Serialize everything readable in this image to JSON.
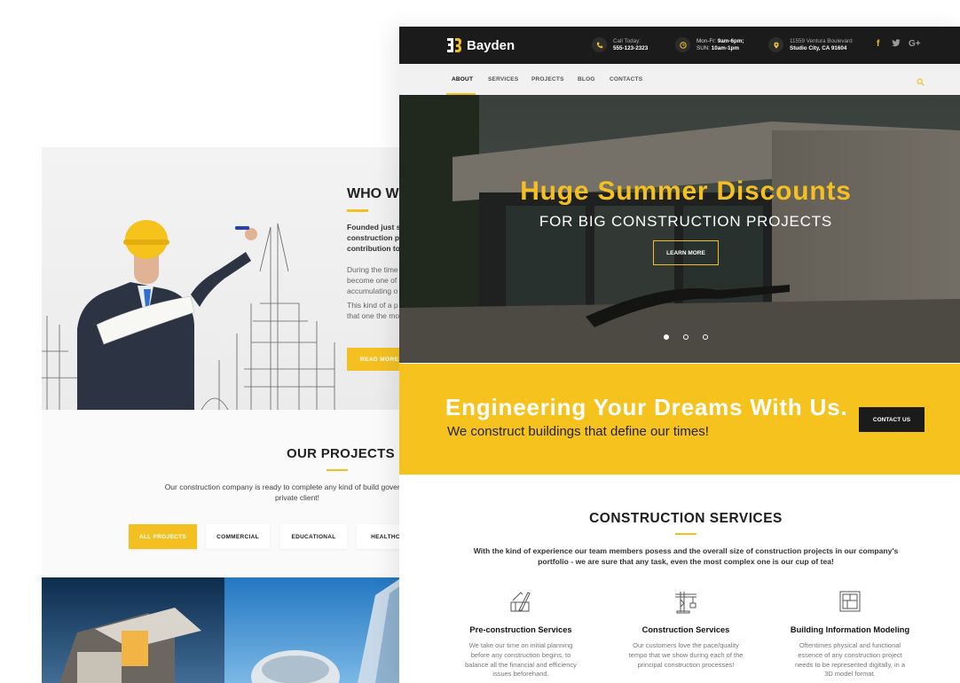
{
  "colors": {
    "accent": "#f4c021",
    "dark": "#1b1b1b",
    "band": "#f6c31e"
  },
  "back_page": {
    "who_title": "WHO W",
    "who_bold": "Founded just s construction p contribution to",
    "who_text_1": "During the time become one of accumulating o",
    "who_text_2": "This kind of a p sitting that one the most accla",
    "read_more": "READ MORE",
    "projects_title": "OUR PROJECTS",
    "projects_text": "Our construction company is ready to complete any kind of build government or private client!",
    "filters": [
      {
        "label": "ALL PROJECTS",
        "active": true
      },
      {
        "label": "COMMERCIAL",
        "active": false
      },
      {
        "label": "EDUCATIONAL",
        "active": false
      },
      {
        "label": "HEALTHCA",
        "active": false
      }
    ]
  },
  "site": {
    "logo_text": "Bayden",
    "logo_icon": "bayden-logo-icon",
    "contacts": [
      {
        "icon": "phone-icon",
        "line1": "Call Today:",
        "line2": "555-123-2323"
      },
      {
        "icon": "clock-icon",
        "line1": "Mon-Fr: ",
        "line1_bold": "9am-6pm;",
        "line2_prefix": "SUN: ",
        "line2": "10am-1pm"
      },
      {
        "icon": "location-pin-icon",
        "line1": "11559 Ventura Boulevard",
        "line2": "Studio City, CA 91604"
      }
    ],
    "social": [
      {
        "icon": "facebook-icon",
        "glyph": "f"
      },
      {
        "icon": "twitter-icon",
        "glyph": "🐦"
      },
      {
        "icon": "google-plus-icon",
        "glyph": "G+"
      }
    ],
    "nav": [
      "ABOUT",
      "SERVICES",
      "PROJECTS",
      "BLOG",
      "CONTACTS"
    ],
    "nav_active": "ABOUT",
    "hero": {
      "title": "Huge Summer Discounts",
      "subtitle": "FOR BIG CONSTRUCTION PROJECTS",
      "button": "LEARN MORE",
      "slides": 3,
      "active_slide": 1
    },
    "band": {
      "title": "Engineering Your Dreams With Us.",
      "subtitle": "We construct buildings that define our times!",
      "button": "CONTACT US"
    },
    "services": {
      "title": "CONSTRUCTION SERVICES",
      "intro": "With the kind of experience our team members posess and the overall size of construction projects in our company's portfolio - we are sure that any task, even the most complex one is our cup of tea!",
      "items": [
        {
          "icon": "blueprint-tools-icon",
          "title": "Pre-construction Services",
          "text": "We take our time on initial planning before any construction begins, to balance all the financial and efficiency issues beforehand."
        },
        {
          "icon": "crane-icon",
          "title": "Construction Services",
          "text": "Our customers love the pace/quality tempo that we show during each of the principal construction processes!"
        },
        {
          "icon": "floor-plan-icon",
          "title": "Building Information Modeling",
          "text": "Oftentimes physical and functional essence of any construction project needs to be represented digitally, in a 3D model format."
        }
      ]
    }
  }
}
